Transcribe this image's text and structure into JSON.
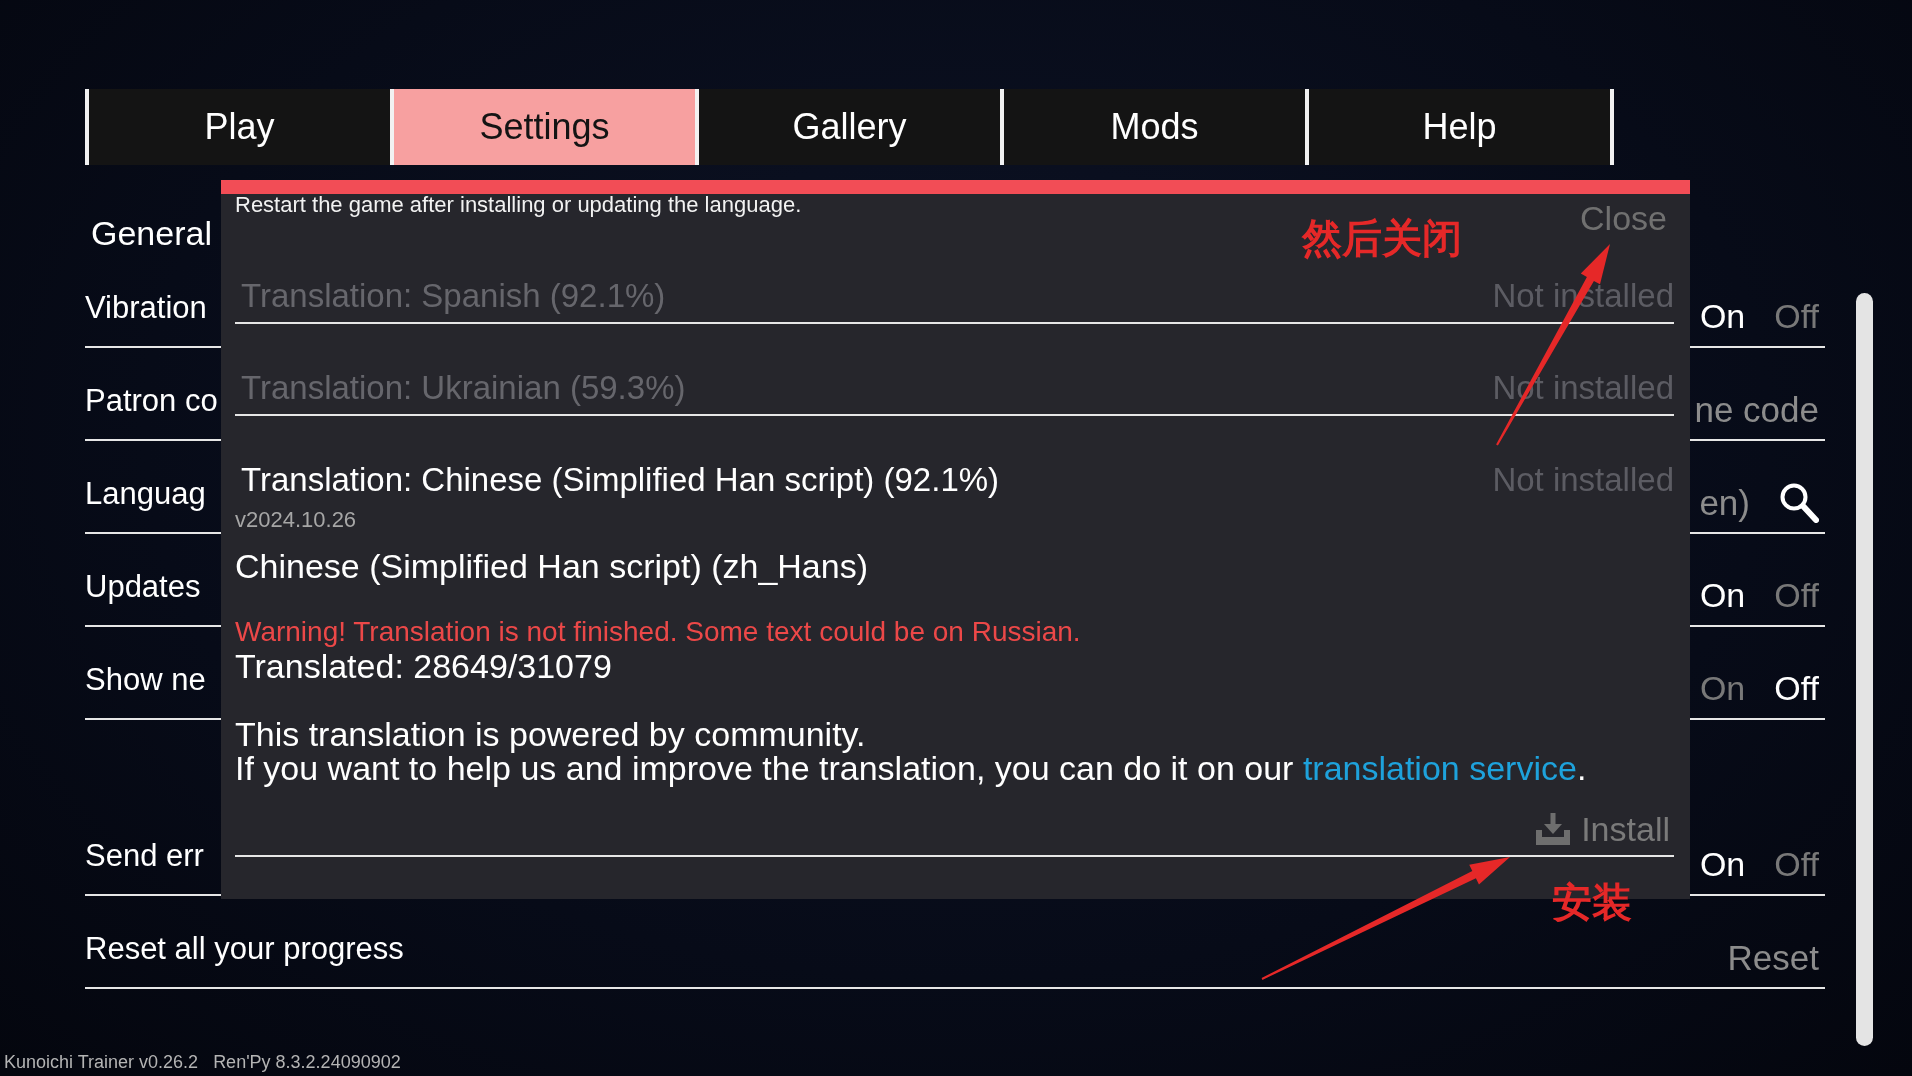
{
  "tabs": [
    {
      "label": "Play",
      "selected": false
    },
    {
      "label": "Settings",
      "selected": true
    },
    {
      "label": "Gallery",
      "selected": false
    },
    {
      "label": "Mods",
      "selected": false
    },
    {
      "label": "Help",
      "selected": false
    }
  ],
  "settings": {
    "groups": [
      {
        "title": "General",
        "rows": [
          {
            "kind": "toggle",
            "label": "Vibration",
            "options": [
              {
                "label": "On",
                "selected": true
              },
              {
                "label": "Off",
                "selected": false
              }
            ]
          },
          {
            "kind": "text",
            "label": "Patron co",
            "value": "ne code"
          },
          {
            "kind": "search",
            "label": "Languag",
            "value": "en)"
          },
          {
            "kind": "toggle",
            "label": "Updates",
            "options": [
              {
                "label": "On",
                "selected": true
              },
              {
                "label": "Off",
                "selected": false
              }
            ]
          },
          {
            "kind": "toggle",
            "label": "Show ne",
            "options": [
              {
                "label": "On",
                "selected": false
              },
              {
                "label": "Off",
                "selected": true
              }
            ]
          }
        ]
      },
      {
        "rows": [
          {
            "kind": "toggle",
            "label": "Send err",
            "options": [
              {
                "label": "On",
                "selected": true
              },
              {
                "label": "Off",
                "selected": false
              }
            ]
          },
          {
            "kind": "button",
            "label": "Reset all your progress",
            "button": "Reset"
          }
        ]
      }
    ]
  },
  "language_dialog": {
    "notice": "Restart the game after installing or updating the language.",
    "close": "Close",
    "languages": [
      {
        "name": "Translation: Spanish (92.1%)",
        "status": "Not installed",
        "selected": false
      },
      {
        "name": "Translation: Ukrainian (59.3%)",
        "status": "Not installed",
        "selected": false
      },
      {
        "name": "Translation: Chinese (Simplified Han script) (92.1%)",
        "status": "Not installed",
        "selected": true,
        "details": {
          "version": "v2024.10.26",
          "locale": "Chinese (Simplified Han script) (zh_Hans)",
          "warning": "Warning! Translation is not finished. Some text could be on Russian.",
          "translated": "Translated: 28649/31079",
          "description": "This translation is powered by community.",
          "help": {
            "text": "If you want to help us and improve the translation, you can do it on our ",
            "link": "translation service",
            "after": "."
          },
          "action": "Install"
        }
      }
    ]
  },
  "annotations": [
    {
      "text": "然后关闭"
    },
    {
      "text": "安装"
    }
  ],
  "footer": {
    "game_version": "Kunoichi Trainer v0.26.2",
    "engine_version": "Ren'Py 8.3.2.24090902"
  }
}
